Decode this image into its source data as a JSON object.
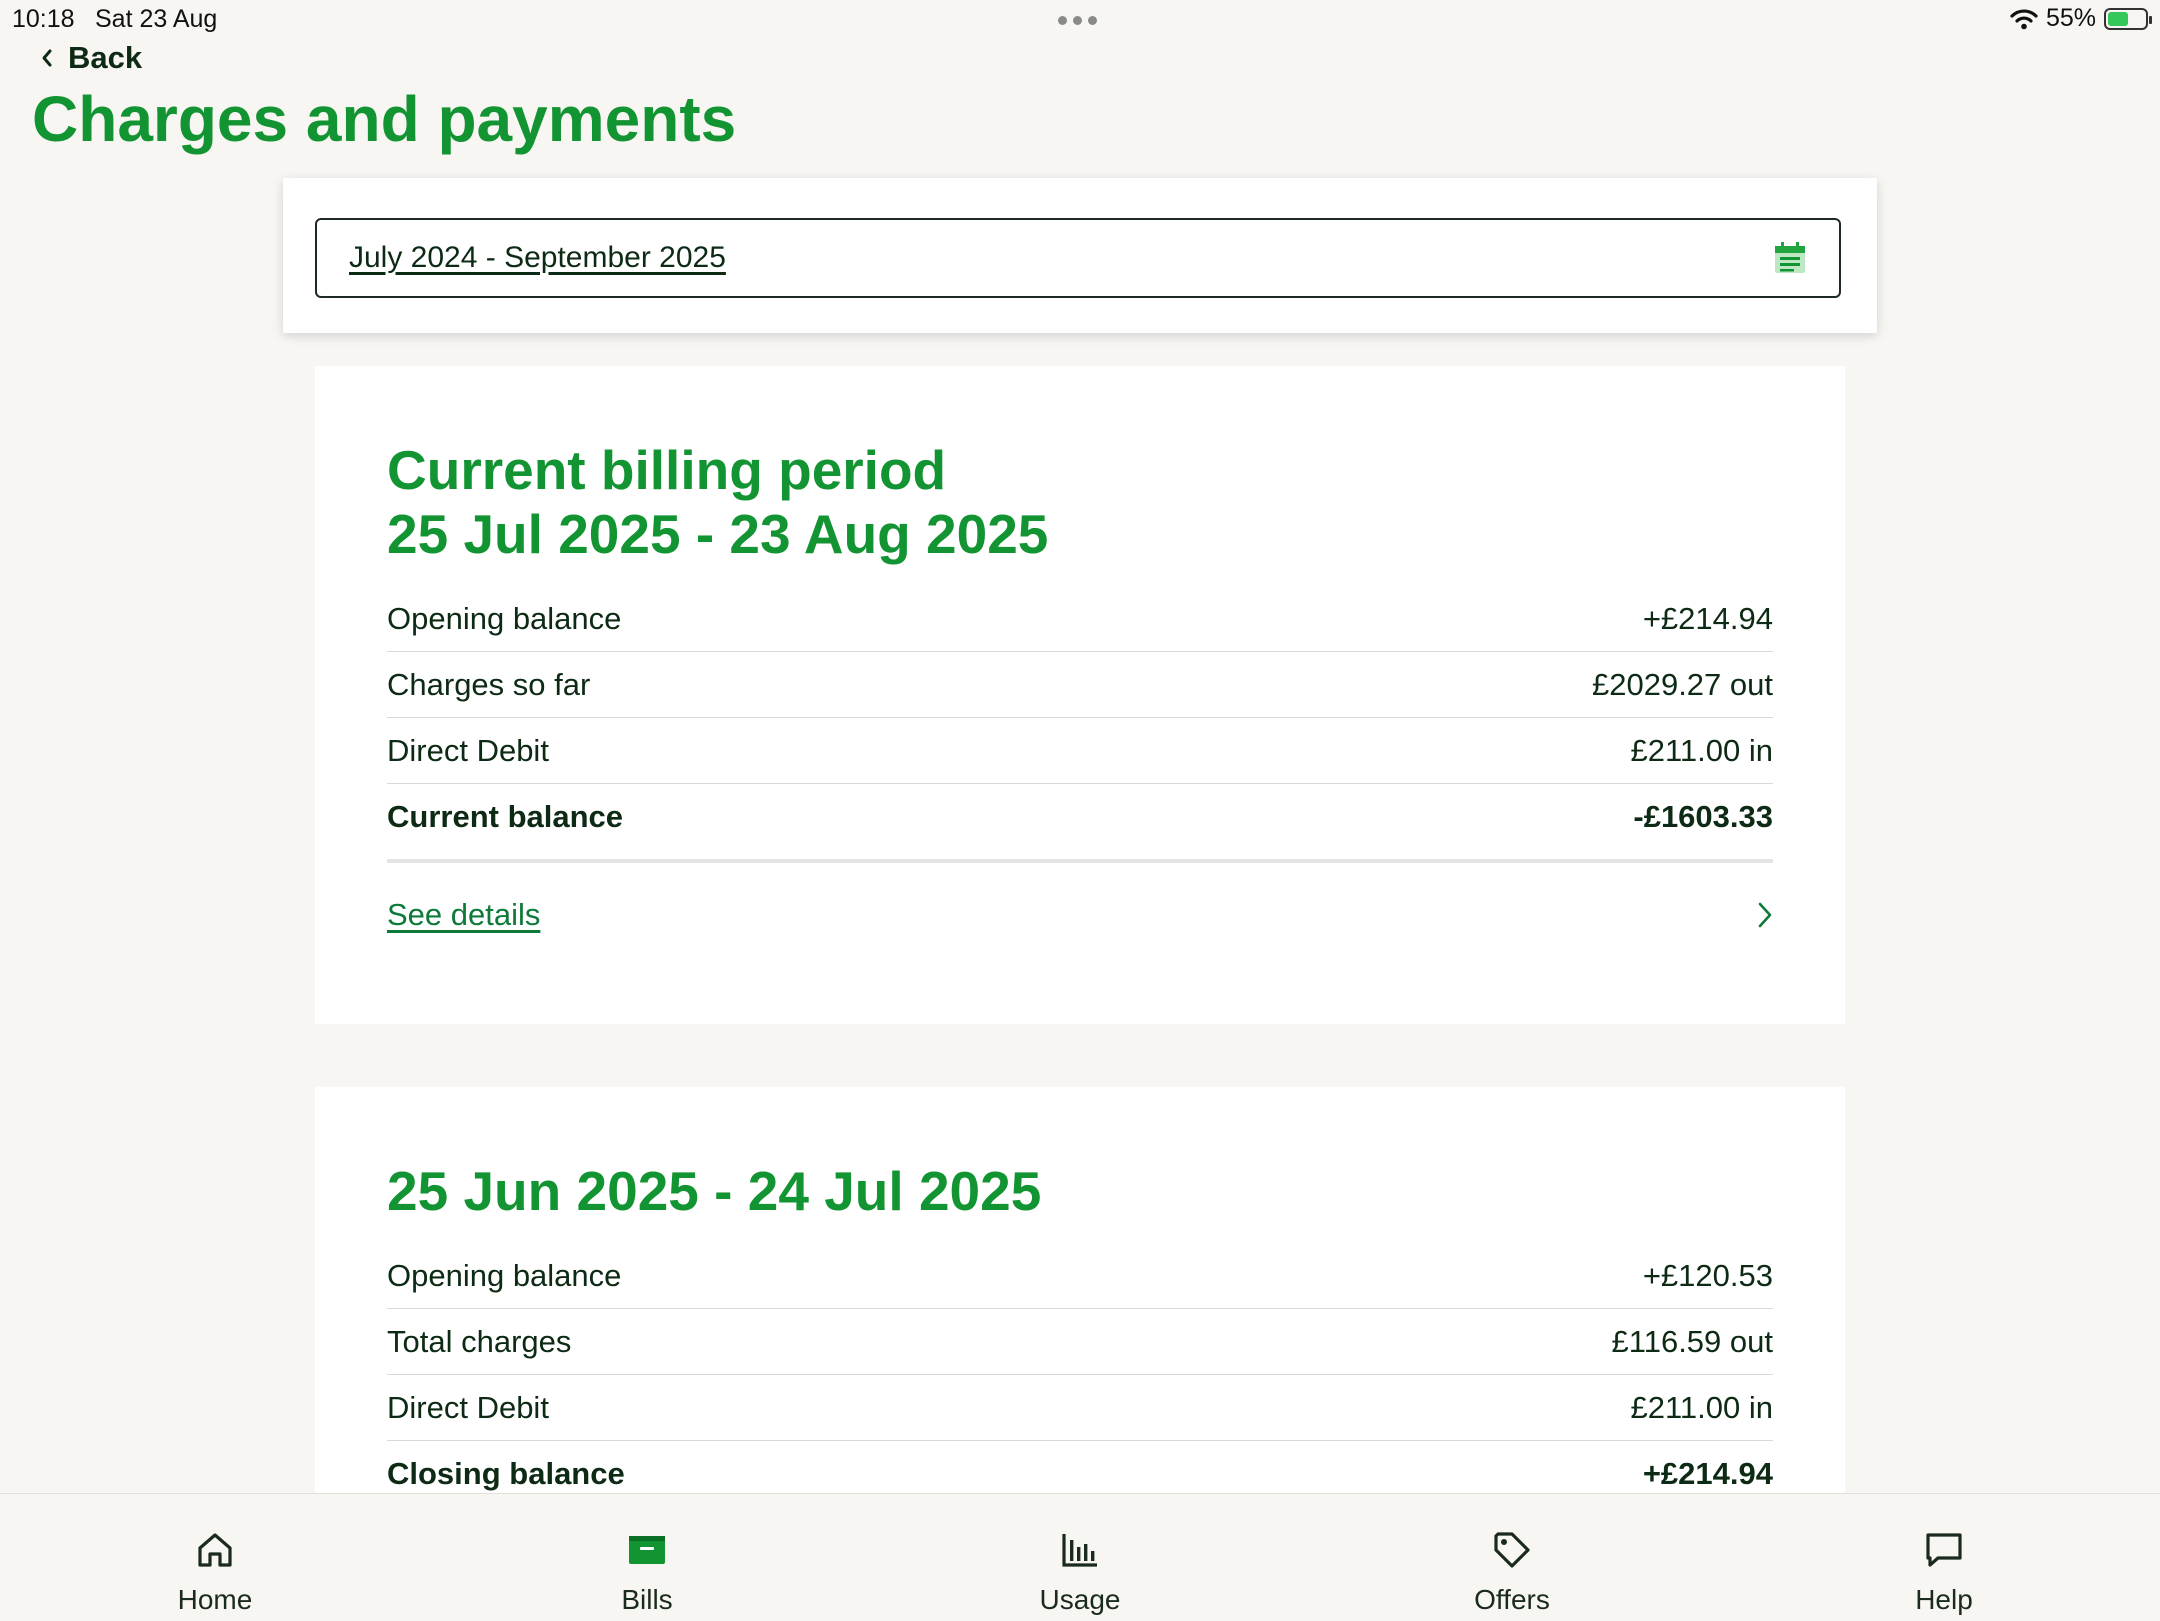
{
  "status_bar": {
    "time": "10:18",
    "date": "Sat 23 Aug",
    "battery": "55%"
  },
  "nav": {
    "back_label": "Back"
  },
  "page_title": "Charges and payments",
  "date_range": {
    "value": "July 2024 - September 2025"
  },
  "current_period": {
    "title_line1": "Current billing period",
    "title_line2": "25 Jul 2025 - 23 Aug 2025",
    "rows": [
      {
        "label": "Opening balance",
        "value": "+£214.94"
      },
      {
        "label": "Charges so far",
        "value": "£2029.27 out"
      },
      {
        "label": "Direct Debit",
        "value": "£211.00 in"
      },
      {
        "label": "Current balance",
        "value": "-£1603.33"
      }
    ],
    "details_label": "See details"
  },
  "previous_period": {
    "title": "25 Jun 2025 - 24 Jul 2025",
    "rows": [
      {
        "label": "Opening balance",
        "value": "+£120.53"
      },
      {
        "label": "Total charges",
        "value": "£116.59 out"
      },
      {
        "label": "Direct Debit",
        "value": "£211.00 in"
      },
      {
        "label": "Closing balance",
        "value": "+£214.94"
      }
    ]
  },
  "tab_bar": {
    "items": [
      {
        "label": "Home",
        "icon": "home-icon"
      },
      {
        "label": "Bills",
        "icon": "bills-icon"
      },
      {
        "label": "Usage",
        "icon": "usage-icon"
      },
      {
        "label": "Offers",
        "icon": "offers-icon"
      },
      {
        "label": "Help",
        "icon": "help-icon"
      }
    ],
    "active": "Bills"
  },
  "colors": {
    "brand_green": "#139432",
    "dark_text": "#0d2a14",
    "background": "#f8f6f3"
  }
}
